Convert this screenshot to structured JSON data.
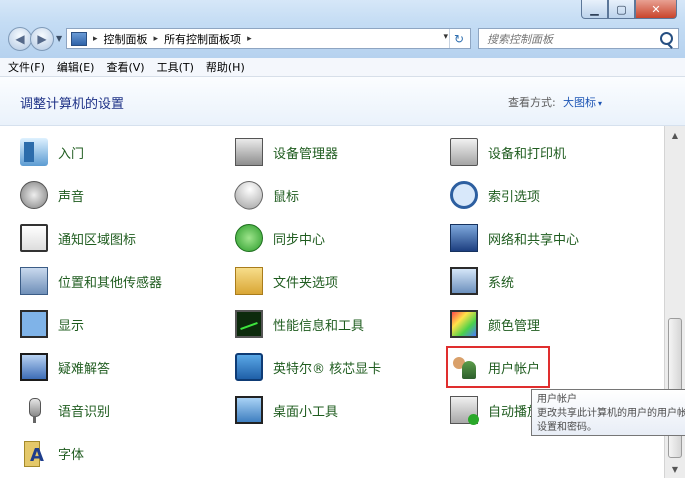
{
  "window": {
    "caption_buttons": {
      "minimize": "▁",
      "maximize": "▢",
      "close": "✕"
    }
  },
  "navigation": {
    "back": "◀",
    "forward": "▶",
    "dropdown": "▼",
    "address": [
      "控制面板",
      "所有控制面板项"
    ],
    "address_dropdown": "▾",
    "refresh": "↻",
    "search_placeholder": "搜索控制面板"
  },
  "menubar": [
    "文件(F)",
    "编辑(E)",
    "查看(V)",
    "工具(T)",
    "帮助(H)"
  ],
  "header": {
    "title": "调整计算机的设置",
    "view_label": "查看方式:",
    "view_value": "大图标",
    "view_arrow": "▾"
  },
  "items": {
    "col1": [
      "入门",
      "声音",
      "通知区域图标",
      "位置和其他传感器",
      "显示",
      "疑难解答",
      "语音识别",
      "字体"
    ],
    "col2": [
      "设备管理器",
      "鼠标",
      "同步中心",
      "文件夹选项",
      "性能信息和工具",
      "英特尔® 核芯显卡",
      "桌面小工具"
    ],
    "col3": [
      "设备和打印机",
      "索引选项",
      "网络和共享中心",
      "系统",
      "颜色管理",
      "用户帐户",
      "自动播放"
    ]
  },
  "icons": {
    "col1": [
      "getting-started-icon",
      "sound-icon",
      "notification-area-icon",
      "location-sensors-icon",
      "display-icon",
      "troubleshooting-icon",
      "speech-recognition-icon",
      "fonts-icon"
    ],
    "col2": [
      "device-manager-icon",
      "mouse-icon",
      "sync-center-icon",
      "folder-options-icon",
      "performance-icon",
      "intel-graphics-icon",
      "desktop-gadgets-icon"
    ],
    "col3": [
      "devices-printers-icon",
      "indexing-options-icon",
      "network-sharing-icon",
      "system-icon",
      "color-management-icon",
      "user-accounts-icon",
      "autoplay-icon"
    ]
  },
  "highlighted_item": "用户帐户",
  "tooltip": {
    "title": "用户帐户",
    "line1": "更改共享此计算机的用户的用户帐",
    "line2": "设置和密码。"
  },
  "scrollbar": {
    "up": "▲",
    "down": "▼"
  },
  "colors": {
    "item_text": "#1f5c1f",
    "title_text": "#1e3287",
    "highlight_border": "#e02e2e",
    "view_value": "#1e56b5"
  }
}
